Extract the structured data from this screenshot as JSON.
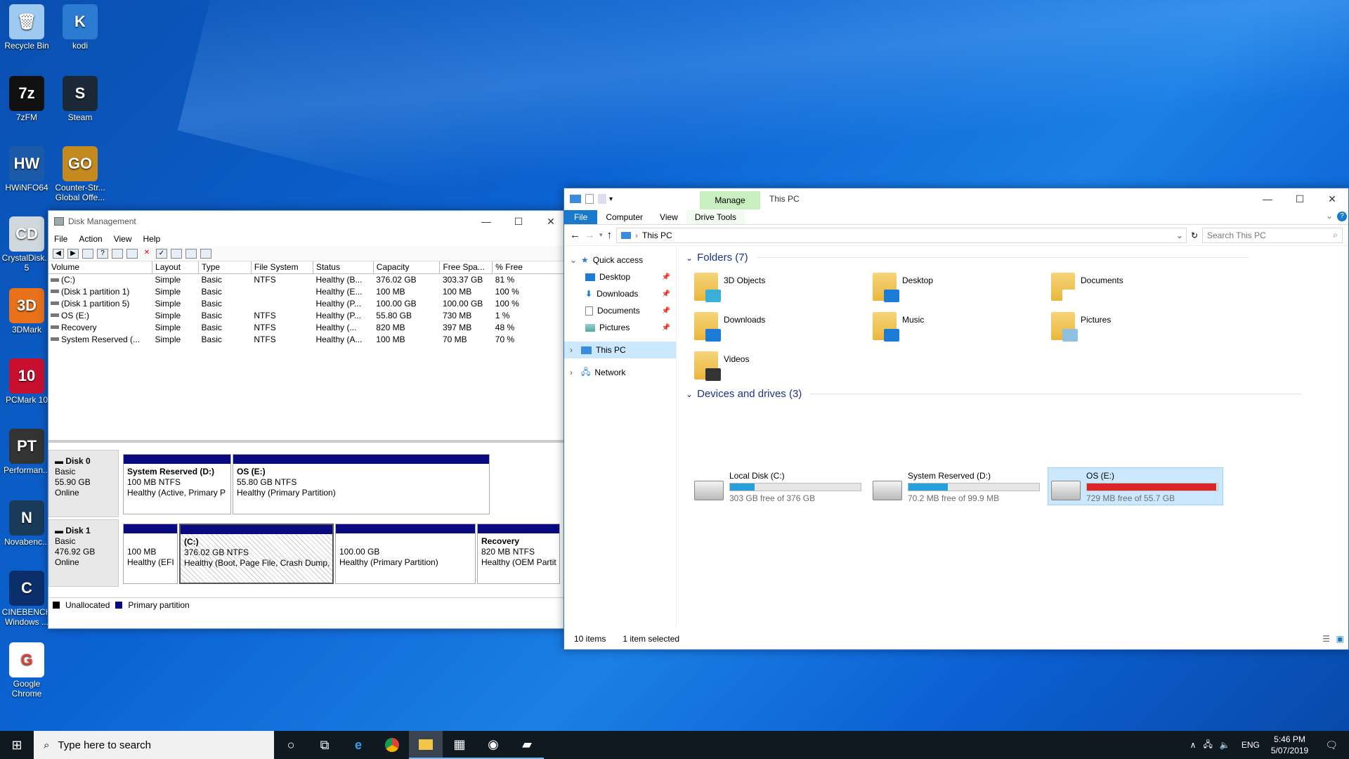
{
  "desktop": {
    "icons": [
      {
        "label": "Recycle Bin",
        "glyph": "🗑"
      },
      {
        "label": "kodi",
        "glyph": "K"
      },
      {
        "label": "7zFM",
        "glyph": "7z"
      },
      {
        "label": "Steam",
        "glyph": "S"
      },
      {
        "label": "HWiNFO64",
        "glyph": "HW"
      },
      {
        "label": "Counter-Str... Global Offe...",
        "glyph": "GO"
      },
      {
        "label": "CrystalDisk... 5",
        "glyph": "CD"
      },
      {
        "label": "3DMark",
        "glyph": "3D"
      },
      {
        "label": "PCMark 10",
        "glyph": "10"
      },
      {
        "label": "Performan...",
        "glyph": "PT"
      },
      {
        "label": "Novabenc...",
        "glyph": "N"
      },
      {
        "label": "CINEBENCH Windows ...",
        "glyph": "C"
      },
      {
        "label": "Google Chrome",
        "glyph": "G"
      }
    ]
  },
  "disk_mgmt": {
    "title": "Disk Management",
    "menu": [
      "File",
      "Action",
      "View",
      "Help"
    ],
    "columns": [
      "Volume",
      "Layout",
      "Type",
      "File System",
      "Status",
      "Capacity",
      "Free Spa...",
      "% Free"
    ],
    "rows": [
      [
        "(C:)",
        "Simple",
        "Basic",
        "NTFS",
        "Healthy (B...",
        "376.02 GB",
        "303.37 GB",
        "81 %"
      ],
      [
        "(Disk 1 partition 1)",
        "Simple",
        "Basic",
        "",
        "Healthy (E...",
        "100 MB",
        "100 MB",
        "100 %"
      ],
      [
        "(Disk 1 partition 5)",
        "Simple",
        "Basic",
        "",
        "Healthy (P...",
        "100.00 GB",
        "100.00 GB",
        "100 %"
      ],
      [
        "OS (E:)",
        "Simple",
        "Basic",
        "NTFS",
        "Healthy (P...",
        "55.80 GB",
        "730 MB",
        "1 %"
      ],
      [
        "Recovery",
        "Simple",
        "Basic",
        "NTFS",
        "Healthy (...",
        "820 MB",
        "397 MB",
        "48 %"
      ],
      [
        "System Reserved (...",
        "Simple",
        "Basic",
        "NTFS",
        "Healthy (A...",
        "100 MB",
        "70 MB",
        "70 %"
      ]
    ],
    "disk0": {
      "name": "Disk 0",
      "type": "Basic",
      "size": "55.90 GB",
      "state": "Online",
      "parts": [
        {
          "name": "System Reserved  (D:)",
          "size": "100 MB NTFS",
          "status": "Healthy (Active, Primary P"
        },
        {
          "name": "OS  (E:)",
          "size": "55.80 GB NTFS",
          "status": "Healthy (Primary Partition)"
        }
      ]
    },
    "disk1": {
      "name": "Disk 1",
      "type": "Basic",
      "size": "476.92 GB",
      "state": "Online",
      "parts": [
        {
          "name": "",
          "size": "100 MB",
          "status": "Healthy (EFI"
        },
        {
          "name": "(C:)",
          "size": "376.02 GB NTFS",
          "status": "Healthy (Boot, Page File, Crash Dump, V"
        },
        {
          "name": "",
          "size": "100.00 GB",
          "status": "Healthy (Primary Partition)"
        },
        {
          "name": "Recovery",
          "size": "820 MB NTFS",
          "status": "Healthy (OEM Partit"
        }
      ]
    },
    "legend": [
      "Unallocated",
      "Primary partition"
    ]
  },
  "explorer": {
    "title": "This PC",
    "manage": "Manage",
    "tabs": [
      "File",
      "Computer",
      "View",
      "Drive Tools"
    ],
    "address": "This PC",
    "search_placeholder": "Search This PC",
    "nav": [
      {
        "label": "Quick access"
      },
      {
        "label": "Desktop"
      },
      {
        "label": "Downloads"
      },
      {
        "label": "Documents"
      },
      {
        "label": "Pictures"
      },
      {
        "label": "This PC"
      },
      {
        "label": "Network"
      }
    ],
    "folders_header": "Folders (7)",
    "folders": [
      "3D Objects",
      "Desktop",
      "Documents",
      "Downloads",
      "Music",
      "Pictures",
      "Videos"
    ],
    "drives_header": "Devices and drives (3)",
    "drives": [
      {
        "name": "Local Disk (C:)",
        "free": "303 GB free of 376 GB",
        "used_fraction": 0.19,
        "color": "#26a0da"
      },
      {
        "name": "System Reserved (D:)",
        "free": "70.2 MB free of 99.9 MB",
        "used_fraction": 0.3,
        "color": "#26a0da"
      },
      {
        "name": "OS (E:)",
        "free": "729 MB free of 55.7 GB",
        "used_fraction": 0.99,
        "color": "#da2626"
      }
    ],
    "status_items": "10 items",
    "status_selected": "1 item selected"
  },
  "taskbar": {
    "search_placeholder": "Type here to search",
    "lang": "ENG",
    "time": "5:46 PM",
    "date": "5/07/2019"
  }
}
